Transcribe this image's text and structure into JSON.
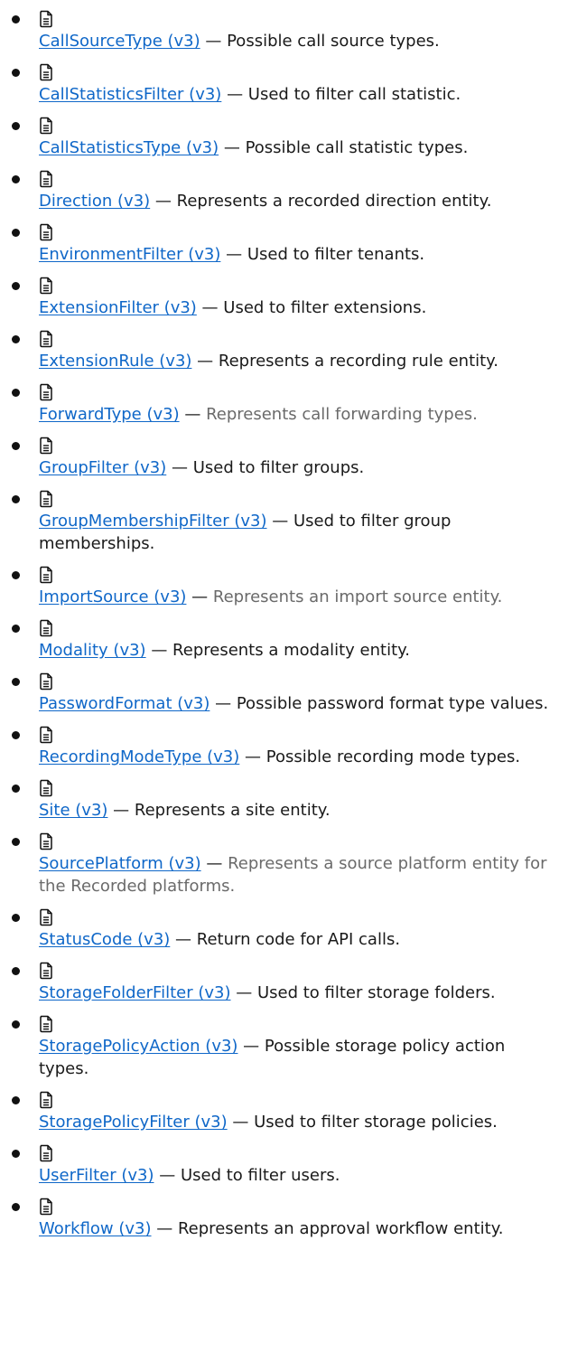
{
  "separator": " — ",
  "entries": [
    {
      "link": "CallSourceType (v3)",
      "desc": "Possible call source types.",
      "muted": false
    },
    {
      "link": "CallStatisticsFilter (v3)",
      "desc": "Used to filter call statistic.",
      "muted": false
    },
    {
      "link": "CallStatisticsType (v3)",
      "desc": "Possible call statistic types.",
      "muted": false
    },
    {
      "link": "Direction (v3)",
      "desc": "Represents a recorded direction entity.",
      "muted": false
    },
    {
      "link": "EnvironmentFilter (v3)",
      "desc": "Used to filter tenants.",
      "muted": false
    },
    {
      "link": "ExtensionFilter (v3)",
      "desc": "Used to filter extensions.",
      "muted": false
    },
    {
      "link": "ExtensionRule (v3)",
      "desc": "Represents a recording rule entity.",
      "muted": false
    },
    {
      "link": "ForwardType (v3)",
      "desc": "Represents call forwarding types.",
      "muted": true
    },
    {
      "link": "GroupFilter (v3)",
      "desc": "Used to filter groups.",
      "muted": false
    },
    {
      "link": "GroupMembershipFilter (v3)",
      "desc": "Used to filter group memberships.",
      "muted": false
    },
    {
      "link": "ImportSource (v3)",
      "desc": "Represents an import source entity.",
      "muted": true
    },
    {
      "link": "Modality (v3)",
      "desc": "Represents a modality entity.",
      "muted": false
    },
    {
      "link": "PasswordFormat (v3)",
      "desc": "Possible password format type values.",
      "muted": false
    },
    {
      "link": "RecordingModeType (v3)",
      "desc": "Possible recording mode types.",
      "muted": false
    },
    {
      "link": "Site (v3)",
      "desc": "Represents a site entity.",
      "muted": false
    },
    {
      "link": "SourcePlatform (v3)",
      "desc": "Represents a source platform entity for the Recorded platforms.",
      "muted": true
    },
    {
      "link": "StatusCode (v3)",
      "desc": "Return code for API calls.",
      "muted": false
    },
    {
      "link": "StorageFolderFilter (v3)",
      "desc": "Used to filter storage folders.",
      "muted": false
    },
    {
      "link": "StoragePolicyAction (v3)",
      "desc": "Possible storage policy action types.",
      "muted": false
    },
    {
      "link": "StoragePolicyFilter (v3)",
      "desc": "Used to filter storage policies.",
      "muted": false
    },
    {
      "link": "UserFilter (v3)",
      "desc": "Used to filter users.",
      "muted": false
    },
    {
      "link": "Workflow (v3)",
      "desc": "Represents an approval workflow entity.",
      "muted": false
    }
  ],
  "icon": "document-icon",
  "colors": {
    "link": "#0f67c8",
    "text": "#1a1a1a",
    "muted_text": "#6a6a6a"
  }
}
